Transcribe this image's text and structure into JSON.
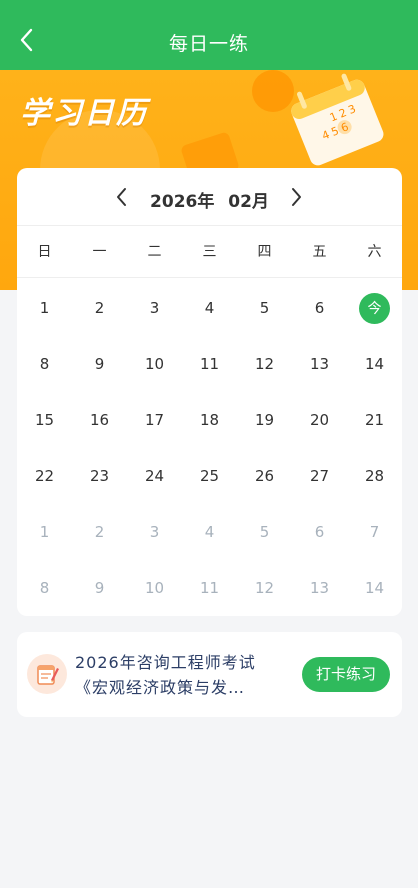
{
  "header": {
    "title": "每日一练"
  },
  "banner": {
    "title": "学习日历",
    "illustration_numbers": [
      "1",
      "2",
      "3",
      "4",
      "5",
      "6"
    ]
  },
  "calendar": {
    "year": "2026年",
    "month": "02月",
    "weekdays": [
      "日",
      "一",
      "二",
      "三",
      "四",
      "五",
      "六"
    ],
    "today_label": "今",
    "days": [
      {
        "label": "1",
        "other": false
      },
      {
        "label": "2",
        "other": false
      },
      {
        "label": "3",
        "other": false
      },
      {
        "label": "4",
        "other": false
      },
      {
        "label": "5",
        "other": false
      },
      {
        "label": "6",
        "other": false
      },
      {
        "label": "今",
        "other": false,
        "today": true
      },
      {
        "label": "8",
        "other": false
      },
      {
        "label": "9",
        "other": false
      },
      {
        "label": "10",
        "other": false
      },
      {
        "label": "11",
        "other": false
      },
      {
        "label": "12",
        "other": false
      },
      {
        "label": "13",
        "other": false
      },
      {
        "label": "14",
        "other": false
      },
      {
        "label": "15",
        "other": false
      },
      {
        "label": "16",
        "other": false
      },
      {
        "label": "17",
        "other": false
      },
      {
        "label": "18",
        "other": false
      },
      {
        "label": "19",
        "other": false
      },
      {
        "label": "20",
        "other": false
      },
      {
        "label": "21",
        "other": false
      },
      {
        "label": "22",
        "other": false
      },
      {
        "label": "23",
        "other": false
      },
      {
        "label": "24",
        "other": false
      },
      {
        "label": "25",
        "other": false
      },
      {
        "label": "26",
        "other": false
      },
      {
        "label": "27",
        "other": false
      },
      {
        "label": "28",
        "other": false
      },
      {
        "label": "1",
        "other": true
      },
      {
        "label": "2",
        "other": true
      },
      {
        "label": "3",
        "other": true
      },
      {
        "label": "4",
        "other": true
      },
      {
        "label": "5",
        "other": true
      },
      {
        "label": "6",
        "other": true
      },
      {
        "label": "7",
        "other": true
      },
      {
        "label": "8",
        "other": true
      },
      {
        "label": "9",
        "other": true
      },
      {
        "label": "10",
        "other": true
      },
      {
        "label": "11",
        "other": true
      },
      {
        "label": "12",
        "other": true
      },
      {
        "label": "13",
        "other": true
      },
      {
        "label": "14",
        "other": true
      }
    ]
  },
  "exam": {
    "title_line1": "2026年咨询工程师考试",
    "title_line2": "《宏观经济政策与发…",
    "checkin_label": "打卡练习"
  },
  "colors": {
    "primary": "#2fba5c",
    "banner": "#ffa70e",
    "text_other_month": "#a8b2bc"
  },
  "icons": {
    "back": "chevron-left-icon",
    "prev": "chevron-left-icon",
    "next": "chevron-right-icon",
    "exam": "exam-book-icon"
  }
}
